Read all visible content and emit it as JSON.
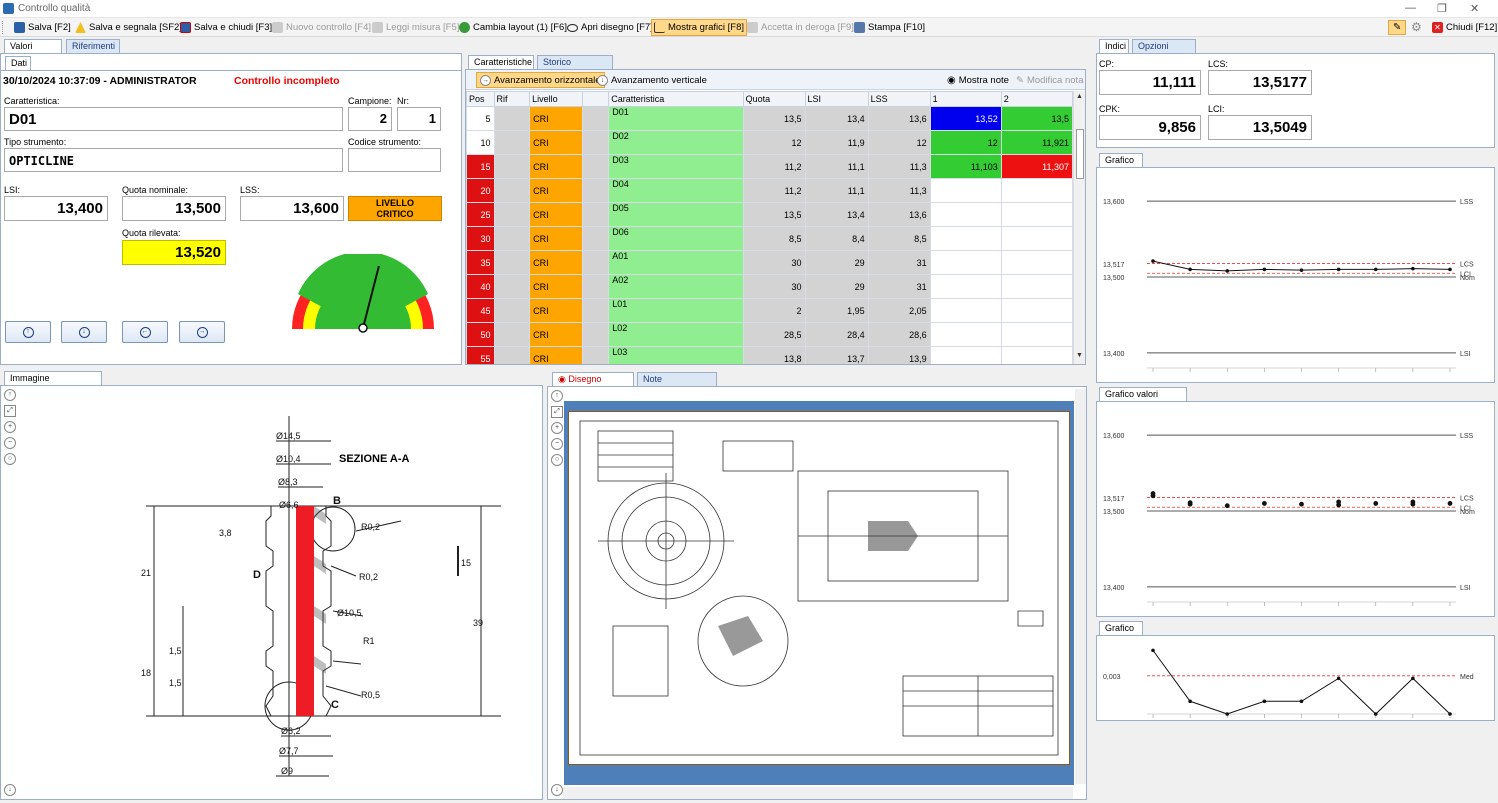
{
  "window": {
    "title": "Controllo qualità"
  },
  "toolbar": [
    {
      "label": "Salva [F2]",
      "icon": "save-icon",
      "state": "normal"
    },
    {
      "label": "Salva e segnala [SF2]",
      "icon": "warning-icon",
      "state": "normal"
    },
    {
      "label": "Salva e chiudi [F3]",
      "icon": "save-close-icon",
      "state": "normal"
    },
    {
      "label": "Nuovo controllo [F4]",
      "icon": "new-icon",
      "state": "disabled"
    },
    {
      "label": "Leggi misura [F5]",
      "icon": "measure-icon",
      "state": "disabled"
    },
    {
      "label": "Cambia layout (1) [F6]",
      "icon": "layout-icon",
      "state": "normal"
    },
    {
      "label": "Apri disegno [F7]",
      "icon": "eye-icon",
      "state": "normal"
    },
    {
      "label": "Mostra grafici [F8]",
      "icon": "chart-icon",
      "state": "active"
    },
    {
      "label": "Accetta in deroga [F9]",
      "icon": "accept-icon",
      "state": "disabled"
    },
    {
      "label": "Stampa [F10]",
      "icon": "print-icon",
      "state": "normal"
    }
  ],
  "close_label": "Chiudi [F12]",
  "left_panel": {
    "tabs": [
      "Valori rilevati",
      "Riferimenti"
    ],
    "subtab": "Dati",
    "datetime_user": "30/10/2024 10:37:09 - ADMINISTRATOR",
    "status": "Controllo incompleto",
    "caratteristica_label": "Caratteristica:",
    "caratteristica": "D01",
    "campione_label": "Campione:",
    "campione": "2",
    "nr_label": "Nr:",
    "nr": "1",
    "tipo_strumento_label": "Tipo strumento:",
    "tipo_strumento": "OPTICLINE",
    "codice_strumento_label": "Codice strumento:",
    "codice_strumento": "",
    "lsi_label": "LSI:",
    "lsi": "13,400",
    "quota_nominale_label": "Quota nominale:",
    "quota_nominale": "13,500",
    "lss_label": "LSS:",
    "lss": "13,600",
    "livello": "LIVELLO CRITICO",
    "quota_rilevata_label": "Quota rilevata:",
    "quota_rilevata": "13,520",
    "gauge_level": 0.58
  },
  "grid": {
    "tabs": [
      "Caratteristiche",
      "Storico rilevazioni"
    ],
    "toolbar": {
      "avanzamento_orizzontale": "Avanzamento orizzontale",
      "avanzamento_verticale": "Avanzamento verticale",
      "mostra_note": "Mostra note",
      "modifica_nota": "Modifica nota"
    },
    "columns": [
      "Pos",
      "Rif",
      "Livello",
      "",
      "Caratteristica",
      "Quota",
      "LSI",
      "LSS",
      "1",
      "2"
    ],
    "rows": [
      {
        "pos": "5",
        "livello": "CRI",
        "car": "D01",
        "quota": "13,5",
        "lsi": "13,4",
        "lss": "13,6",
        "v1": "13,52",
        "v2": "13,5",
        "c1": "#0000ee",
        "c2": "#33cc33",
        "pc": "#ffffff"
      },
      {
        "pos": "10",
        "livello": "CRI",
        "car": "D02",
        "quota": "12",
        "lsi": "11,9",
        "lss": "12",
        "v1": "12",
        "v2": "11,921",
        "c1": "#33cc33",
        "c2": "#33cc33",
        "pc": "#ffffff"
      },
      {
        "pos": "15",
        "livello": "CRI",
        "car": "D03",
        "quota": "11,2",
        "lsi": "11,1",
        "lss": "11,3",
        "v1": "11,103",
        "v2": "11,307",
        "c1": "#33cc33",
        "c2": "#ee1111",
        "pc": "#dd1111"
      },
      {
        "pos": "20",
        "livello": "CRI",
        "car": "D04",
        "quota": "11,2",
        "lsi": "11,1",
        "lss": "11,3",
        "v1": "",
        "v2": "",
        "c1": "",
        "c2": "",
        "pc": "#dd1111"
      },
      {
        "pos": "25",
        "livello": "CRI",
        "car": "D05",
        "quota": "13,5",
        "lsi": "13,4",
        "lss": "13,6",
        "v1": "",
        "v2": "",
        "c1": "",
        "c2": "",
        "pc": "#dd1111"
      },
      {
        "pos": "30",
        "livello": "CRI",
        "car": "D06",
        "quota": "8,5",
        "lsi": "8,4",
        "lss": "8,5",
        "v1": "",
        "v2": "",
        "c1": "",
        "c2": "",
        "pc": "#dd1111"
      },
      {
        "pos": "35",
        "livello": "CRI",
        "car": "A01",
        "quota": "30",
        "lsi": "29",
        "lss": "31",
        "v1": "",
        "v2": "",
        "c1": "",
        "c2": "",
        "pc": "#dd1111"
      },
      {
        "pos": "40",
        "livello": "CRI",
        "car": "A02",
        "quota": "30",
        "lsi": "29",
        "lss": "31",
        "v1": "",
        "v2": "",
        "c1": "",
        "c2": "",
        "pc": "#dd1111"
      },
      {
        "pos": "45",
        "livello": "CRI",
        "car": "L01",
        "quota": "2",
        "lsi": "1,95",
        "lss": "2,05",
        "v1": "",
        "v2": "",
        "c1": "",
        "c2": "",
        "pc": "#dd1111"
      },
      {
        "pos": "50",
        "livello": "CRI",
        "car": "L02",
        "quota": "28,5",
        "lsi": "28,4",
        "lss": "28,6",
        "v1": "",
        "v2": "",
        "c1": "",
        "c2": "",
        "pc": "#dd1111"
      },
      {
        "pos": "55",
        "livello": "CRI",
        "car": "L03",
        "quota": "13,8",
        "lsi": "13,7",
        "lss": "13,9",
        "v1": "",
        "v2": "",
        "c1": "",
        "c2": "",
        "pc": "#dd1111"
      }
    ]
  },
  "image_panel": {
    "tab": "Immagine caratteristica",
    "section_title": "SEZIONE A-A",
    "dims": [
      "Ø14,5",
      "Ø10,4",
      "Ø8,3",
      "Ø6,6",
      "R0,2",
      "R0,2",
      "Ø10,5",
      "R1",
      "R0,5",
      "Ø6,2",
      "Ø7,7",
      "Ø9",
      "15",
      "39",
      "21",
      "18",
      "3,8",
      "1,5",
      "1,5",
      "B",
      "C",
      "D"
    ]
  },
  "drawing_panel": {
    "tabs": [
      "Disegno articolo",
      "Note caratteristica"
    ]
  },
  "indices": {
    "tabs": [
      "Indici",
      "Opzioni grafici"
    ],
    "cp_label": "CP:",
    "cp": "11,111",
    "lcs_label": "LCS:",
    "lcs": "13,5177",
    "cpk_label": "CPK:",
    "cpk": "9,856",
    "lci_label": "LCI:",
    "lci": "13,5049"
  },
  "charts": {
    "grafico_x_title": "Grafico X",
    "grafico_valori_title": "Grafico valori rilevati",
    "grafico_r_title": "Grafico R"
  },
  "chart_data": [
    {
      "type": "line",
      "title": "Grafico X",
      "ylim": [
        13.38,
        13.62
      ],
      "yticks": [
        "13,600",
        "13,517",
        "13,500",
        "13,400"
      ],
      "reference_lines": [
        {
          "label": "LSS",
          "value": 13.6
        },
        {
          "label": "LCS",
          "value": 13.5177
        },
        {
          "label": "LCI",
          "value": 13.5049
        },
        {
          "label": "Nom",
          "value": 13.5
        },
        {
          "label": "LSI",
          "value": 13.4
        }
      ],
      "series": [
        {
          "values": [
            13.521,
            13.51,
            13.508,
            13.51,
            13.509,
            13.51,
            13.51,
            13.511,
            13.51
          ]
        }
      ]
    },
    {
      "type": "scatter",
      "title": "Grafico valori rilevati",
      "ylim": [
        13.38,
        13.62
      ],
      "yticks": [
        "13,600",
        "13,517",
        "13,500",
        "13,400"
      ],
      "reference_lines": [
        {
          "label": "LSS",
          "value": 13.6
        },
        {
          "label": "LCS",
          "value": 13.5177
        },
        {
          "label": "LCI",
          "value": 13.5049
        },
        {
          "label": "Nom",
          "value": 13.5
        },
        {
          "label": "LSI",
          "value": 13.4
        }
      ],
      "points": [
        [
          1,
          13.52
        ],
        [
          1,
          13.523
        ],
        [
          2,
          13.509
        ],
        [
          2,
          13.511
        ],
        [
          3,
          13.507
        ],
        [
          4,
          13.51
        ],
        [
          5,
          13.509
        ],
        [
          6,
          13.508
        ],
        [
          6,
          13.512
        ],
        [
          7,
          13.51
        ],
        [
          8,
          13.509
        ],
        [
          8,
          13.512
        ],
        [
          9,
          13.51
        ]
      ]
    },
    {
      "type": "line",
      "title": "Grafico R",
      "ylim": [
        0,
        0.0055
      ],
      "yticks": [
        "0,003"
      ],
      "reference_lines": [
        {
          "label": "Med",
          "value": 0.003
        }
      ],
      "series": [
        {
          "values": [
            0.005,
            0.001,
            0.0,
            0.001,
            0.001,
            0.0028,
            0.0,
            0.0028,
            0.0
          ]
        }
      ]
    }
  ],
  "colors": {
    "accent_blue": "#1f3d7a",
    "tab_blue": "#dbe7f5",
    "orange": "#ffa500",
    "green": "#90ee90",
    "red": "#dd1111",
    "yellow": "#ffff00"
  }
}
